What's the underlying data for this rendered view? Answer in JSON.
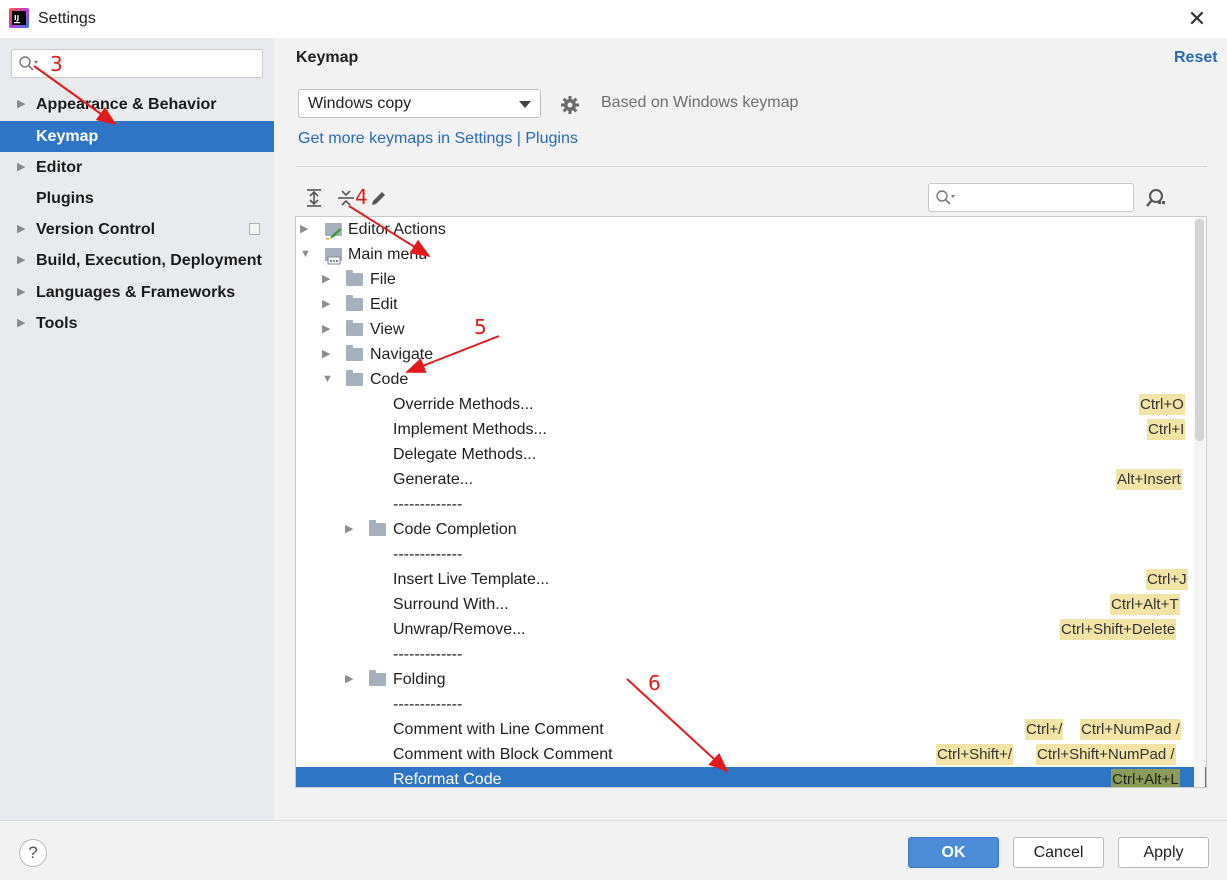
{
  "window": {
    "title": "Settings",
    "close_icon": "close-icon"
  },
  "sidebar": {
    "search_placeholder": "",
    "items": [
      {
        "label": "Appearance & Behavior",
        "expandable": true
      },
      {
        "label": "Keymap",
        "expandable": false,
        "selected": true
      },
      {
        "label": "Editor",
        "expandable": true
      },
      {
        "label": "Plugins",
        "expandable": false
      },
      {
        "label": "Version Control",
        "expandable": true
      },
      {
        "label": "Build, Execution, Deployment",
        "expandable": true
      },
      {
        "label": "Languages & Frameworks",
        "expandable": true
      },
      {
        "label": "Tools",
        "expandable": true
      }
    ]
  },
  "main": {
    "heading": "Keymap",
    "reset_label": "Reset",
    "keymap_select": "Windows copy",
    "based_on": "Based on Windows keymap",
    "get_more_link": "Get more keymaps in Settings | Plugins",
    "filter_placeholder": ""
  },
  "tree": {
    "rows": [
      {
        "label": "Editor Actions",
        "shortcuts": []
      },
      {
        "label": "Main menu",
        "shortcuts": []
      },
      {
        "label": "File",
        "shortcuts": []
      },
      {
        "label": "Edit",
        "shortcuts": []
      },
      {
        "label": "View",
        "shortcuts": []
      },
      {
        "label": "Navigate",
        "shortcuts": []
      },
      {
        "label": "Code",
        "shortcuts": []
      },
      {
        "label": "Override Methods...",
        "shortcuts": [
          "Ctrl+O"
        ]
      },
      {
        "label": "Implement Methods...",
        "shortcuts": [
          "Ctrl+I"
        ]
      },
      {
        "label": "Delegate Methods...",
        "shortcuts": []
      },
      {
        "label": "Generate...",
        "shortcuts": [
          "Alt+Insert"
        ]
      },
      {
        "label": "-------------",
        "shortcuts": []
      },
      {
        "label": "Code Completion",
        "shortcuts": []
      },
      {
        "label": "-------------",
        "shortcuts": []
      },
      {
        "label": "Insert Live Template...",
        "shortcuts": [
          "Ctrl+J"
        ]
      },
      {
        "label": "Surround With...",
        "shortcuts": [
          "Ctrl+Alt+T"
        ]
      },
      {
        "label": "Unwrap/Remove...",
        "shortcuts": [
          "Ctrl+Shift+Delete"
        ]
      },
      {
        "label": "-------------",
        "shortcuts": []
      },
      {
        "label": "Folding",
        "shortcuts": []
      },
      {
        "label": "-------------",
        "shortcuts": []
      },
      {
        "label": "Comment with Line Comment",
        "shortcuts": [
          "Ctrl+/",
          "Ctrl+NumPad /"
        ]
      },
      {
        "label": "Comment with Block Comment",
        "shortcuts": [
          "Ctrl+Shift+/",
          "Ctrl+Shift+NumPad /"
        ]
      },
      {
        "label": "Reformat Code",
        "shortcuts": [
          "Ctrl+Alt+L"
        ]
      }
    ]
  },
  "buttons": {
    "help": "?",
    "ok": "OK",
    "cancel": "Cancel",
    "apply": "Apply"
  },
  "annotations": {
    "n3": "3",
    "n4": "4",
    "n5": "5",
    "n6": "6"
  },
  "colors": {
    "selection": "#2f75c5",
    "link": "#2a6ab2",
    "annotation": "#e11b1b",
    "shortcut_bg": "#f1e4a6"
  }
}
